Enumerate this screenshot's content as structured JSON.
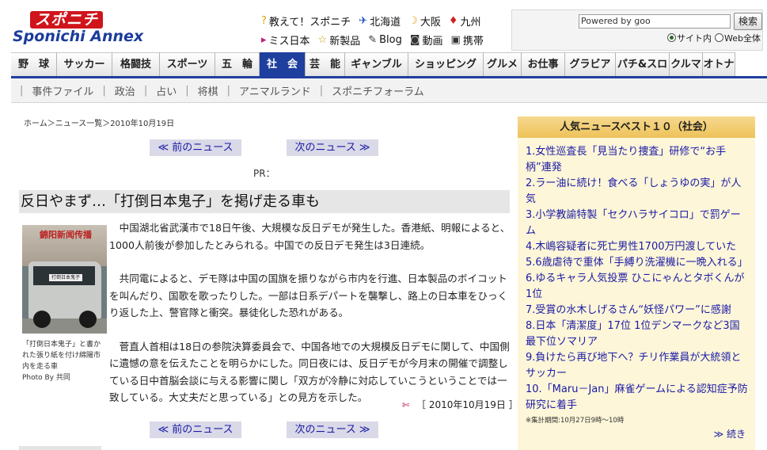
{
  "header": {
    "logo_top": "スポニチ",
    "logo_bottom": "Sponichi Annex",
    "links_row1": [
      {
        "icon": "question-icon",
        "glyph": "?",
        "label": "教えて！スポニチ"
      },
      {
        "icon": "hokkaido-icon",
        "glyph": "✈",
        "label": "北海道"
      },
      {
        "icon": "moon-icon",
        "glyph": "☽",
        "label": "大阪"
      },
      {
        "icon": "kyushu-icon",
        "glyph": "♦",
        "label": "九州"
      }
    ],
    "links_row2": [
      {
        "icon": "triangle-icon",
        "glyph": "▸",
        "label": "ミス日本"
      },
      {
        "icon": "star-icon",
        "glyph": "☆",
        "label": "新製品"
      },
      {
        "icon": "pen-icon",
        "glyph": "✎",
        "label": "Blog"
      },
      {
        "icon": "camera-icon",
        "glyph": "◙",
        "label": "動画"
      },
      {
        "icon": "phone-icon",
        "glyph": "▣",
        "label": "携帯"
      }
    ]
  },
  "search": {
    "value": "Powered by goo",
    "button": "検索",
    "option_site": "サイト内",
    "option_web": "Web全体"
  },
  "nav": {
    "items": [
      "野　球",
      "サッカー",
      "格闘技",
      "スポーツ",
      "五　輪",
      "社　会",
      "芸　能",
      "ギャンブル",
      "ショッピング",
      "グルメ",
      "お仕事",
      "グラビア",
      "パチ&スロ",
      "クルマ",
      "オトナ"
    ],
    "active_index": 5
  },
  "subnav": [
    "事件ファイル",
    "政治",
    "占い",
    "将棋",
    "アニマルランド",
    "スポニチフォーラム"
  ],
  "breadcrumb": "ホーム＞ニュース一覧＞2010年10月19日",
  "pager": {
    "prev": "≪ 前のニュース",
    "next": "次のニュース ≫"
  },
  "pr": "PR：",
  "article": {
    "headline": "反日やまず…「打倒日本鬼子」を掲げ走る車も",
    "photo_caption": "「打倒日本鬼子」と書かれた張り紙を付け綿陽市内を走る車",
    "photo_credit": "Photo By 共同",
    "photo_sign": "打倒日本鬼子",
    "photo_building": "錦阳新闻传播",
    "paragraphs": [
      "中国湖北省武漢市で18日午後、大規模な反日デモが発生した。香港紙、明報によると、1000人前後が参加したとみられる。中国での反日デモ発生は3日連続。",
      "共同電によると、デモ隊は中国の国旗を振りながら市内を行進、日本製品のボイコットを叫んだり、国歌を歌ったりした。一部は日系デパートを襲撃し、路上の日本車をひっくり返した上、警官隊と衝突。暴徒化した恐れがある。",
      "菅直人首相は18日の参院決算委員会で、中国各地での大規模反日デモに関して、中国側に遺憾の意を伝えたことを明らかにした。同日夜には、反日デモが今月末の開催で調整している日中首脳会談に与える影響に関し「双方が冷静に対応していこうということでは一致している。大丈夫だと思っている」との見方を示した。"
    ],
    "date": "［ 2010年10月19日 ］"
  },
  "sidebar": {
    "title": "人気ニュースベスト１０（社会）",
    "items": [
      "1.女性巡査長「見当たり捜査」研修で“お手柄”連発",
      "2.ラー油に続け！食べる「しょうゆの実」が人気",
      "3.小学教諭特製「セクハラサイコロ」で罰ゲーム",
      "4.木嶋容疑者に死亡男性1700万円渡していた",
      "5.6歳虐待で重体「手縛り洗濯機に一晩入れる」",
      "6.ゆるキャラ人気投票 ひこにゃんとタボくんが1位",
      "7.受賞の水木しげるさん“妖怪パワー”に感謝",
      "8.日本「清潔度」17位 1位デンマークなど3国最下位ソマリア",
      "9.負けたら再び地下へ？チリ作業員が大統領とサッカー",
      "10.「Maru－Jan」麻雀ゲームによる認知症予防研究に着手"
    ],
    "note": "※集計期間:10月27日9時～10時",
    "more": "≫ 続き"
  },
  "colors": {
    "nav_active": "#1f3f9f",
    "link": "#1a1aa6",
    "sidebar_bg": "#fdf6d8",
    "sidebar_title": "#f0c866"
  }
}
